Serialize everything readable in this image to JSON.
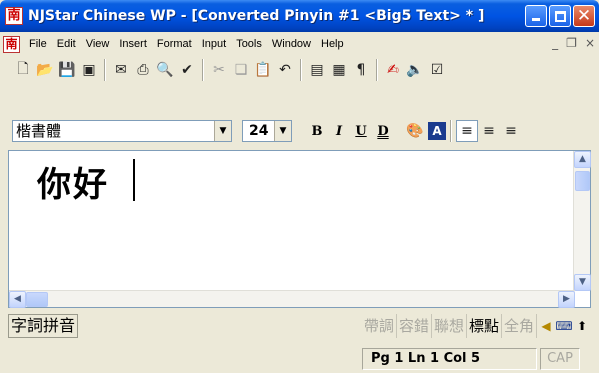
{
  "window": {
    "title": "NJStar Chinese WP - [Converted Pinyin #1 <Big5 Text> * ]",
    "app_icon_glyph": "南",
    "buttons": {
      "minimize_icon": "minimize-icon",
      "maximize_icon": "maximize-icon",
      "close_icon": "close-icon"
    }
  },
  "menu": {
    "doc_icon_glyph": "南",
    "items": [
      "File",
      "Edit",
      "View",
      "Insert",
      "Format",
      "Input",
      "Tools",
      "Window",
      "Help"
    ],
    "mdi": {
      "minimize": "_",
      "restore": "❐",
      "close": "×"
    }
  },
  "toolbar": {
    "icons": [
      "new-file-icon",
      "open-folder-icon",
      "save-icon",
      "save-all-icon",
      "mail-icon",
      "print-icon",
      "print-preview-icon",
      "spell-check-icon",
      "cut-icon",
      "copy-icon",
      "paste-icon",
      "undo-icon",
      "document-view-icon",
      "char-grid-icon",
      "pilcrow-icon",
      "stroke-icon",
      "speaker-icon",
      "options-icon"
    ]
  },
  "format": {
    "font_name": "楷書體",
    "font_size": "24",
    "bold": "B",
    "italic": "I",
    "underline": "U",
    "double_underline": "D",
    "palette_icon": "palette-icon",
    "highlight": "A"
  },
  "document": {
    "text": "你好"
  },
  "ime": {
    "mode": "字詞拼音",
    "options": [
      {
        "label": "帶調",
        "active": false
      },
      {
        "label": "容錯",
        "active": false
      },
      {
        "label": "聯想",
        "active": false
      },
      {
        "label": "標點",
        "active": true
      },
      {
        "label": "全角",
        "active": false
      }
    ]
  },
  "status": {
    "position": "Pg 1   Ln 1   Col 5",
    "cap": "CAP"
  },
  "colors": {
    "title_bar": "#0054e3",
    "close_button": "#c6391a",
    "chrome": "#ece9d8"
  }
}
